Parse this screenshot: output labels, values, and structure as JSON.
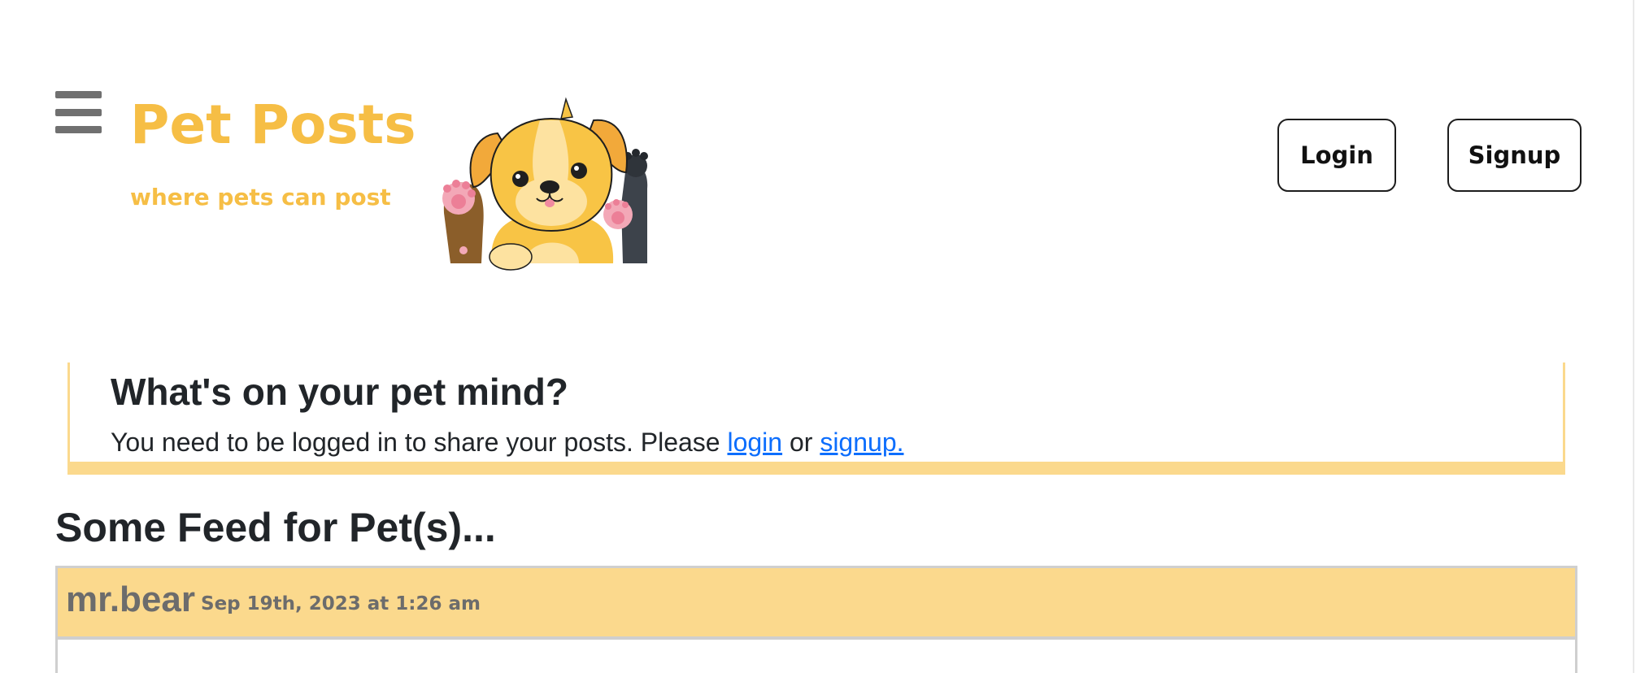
{
  "header": {
    "menu_icon": "hamburger-menu-icon",
    "title": "Pet Posts",
    "tagline": "where pets can post",
    "mascot": "waving-puppy-illustration",
    "login_label": "Login",
    "signup_label": "Signup"
  },
  "prompt": {
    "title": "What's on your pet mind?",
    "text_before": "You need to be logged in to share your posts. Please ",
    "login_link": "login",
    "text_middle": " or ",
    "signup_link": "signup."
  },
  "feed": {
    "title": "Some Feed for Pet(s)...",
    "posts": [
      {
        "author": "mr.bear",
        "date": "Sep 19th, 2023 at 1:26 am"
      }
    ]
  },
  "colors": {
    "brand_yellow": "#f6be45",
    "card_yellow": "#fbd98d",
    "link_blue": "#0d6efd",
    "text_dark": "#212529",
    "muted_gray": "#6c6c6c"
  }
}
